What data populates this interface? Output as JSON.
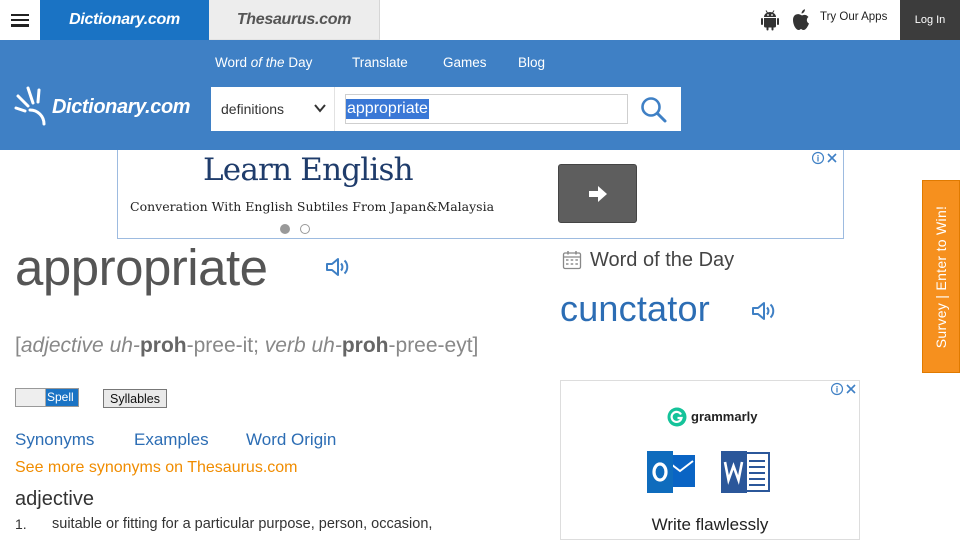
{
  "topbar": {
    "tab_dictionary": "Dictionary.com",
    "tab_thesaurus": "Thesaurus.com",
    "try_apps": "Try Our Apps",
    "login": "Log In"
  },
  "header": {
    "logo_text": "Dictionary.com",
    "nav": {
      "wotd_word": "Word",
      "wotd_em": "of the",
      "wotd_day": "Day",
      "translate": "Translate",
      "games": "Games",
      "blog": "Blog"
    },
    "search": {
      "select_value": "definitions",
      "query": "appropriate"
    }
  },
  "ad_top": {
    "title": "Learn English",
    "subtitle": "Converation With English Subtiles From Japan&Malaysia"
  },
  "entry": {
    "headword": "appropriate",
    "pron": {
      "open": "[",
      "pos1": "adjective",
      "p1a": "uh-",
      "p1b": "proh",
      "p1c": "-pree-it;",
      "pos2": "verb",
      "p2a": "uh-",
      "p2b": "proh",
      "p2c": "-pree-eyt",
      "close": "]"
    },
    "spell_label": "Spell",
    "syllables_label": "Syllables",
    "tabs": {
      "synonyms": "Synonyms",
      "examples": "Examples",
      "origin": "Word Origin"
    },
    "more_synonyms": "See more synonyms on Thesaurus.com",
    "pos_heading": "adjective",
    "definitions": [
      {
        "num": "1.",
        "text": "suitable or fitting for a particular purpose, person, occasion,"
      }
    ]
  },
  "wotd": {
    "label": "Word of the Day",
    "word": "cunctator"
  },
  "ad_right": {
    "brand": "grammarly",
    "cta": "Write flawlessly"
  },
  "survey": {
    "text": "Survey | Enter to Win!"
  },
  "colors": {
    "brand_blue": "#3f80c5",
    "tab_blue": "#1a73c4",
    "link_blue": "#2c6db4",
    "orange": "#f6901e"
  }
}
